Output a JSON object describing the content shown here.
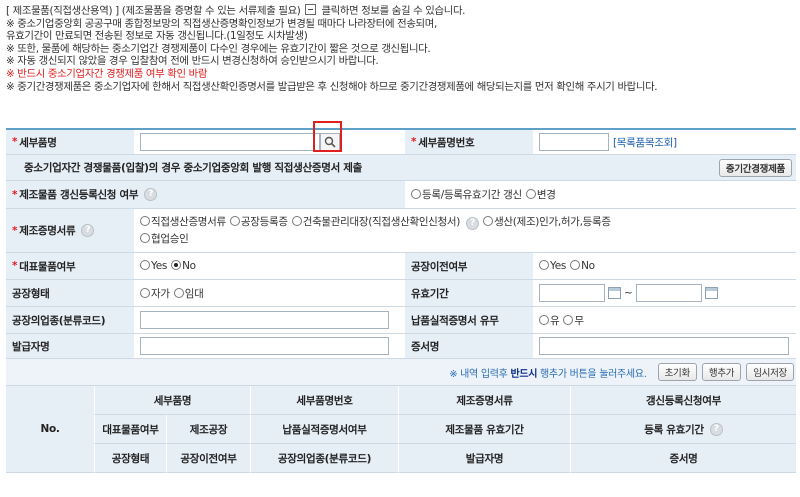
{
  "notice": {
    "line1_prefix": "[ 제조물품(직접생산용역) ] (제조물품을 증명할 수 있는 서류제출 필요)",
    "line1_suffix": "클릭하면 정보를 숨길 수 있습니다.",
    "line2": "※ 중소기업중앙회 공공구매 종합정보망의 직접생산증명확인정보가 변경될 때마다 나라장터에 전송되며,",
    "line3": "유효기간이 만료되면 전송된 정보로 자동 갱신됩니다.(1일정도 시차발생)",
    "line4": "※ 또한, 물품에 해당하는 중소기업간 경쟁제품이 다수인 경우에는 유효기간이 짧은 것으로 갱신됩니다.",
    "line5": "※ 자동 갱신되지 않았을 경우 입찰참여 전에 반드시 변경신청하여 승인받으시기 바랍니다.",
    "line6_red": "※ 반드시 중소기업자간 경쟁제품 여부 확인 바람",
    "line7": "※ 중기간경쟁제품은 중소기업자에 한해서 직접생산확인증명서를 발급받은 후 신청해야 하므로 중기간경쟁제품에 해당되는지를 먼저 확인해 주시기 바랍니다."
  },
  "form": {
    "detail_item_name_label": "세부품명",
    "detail_item_number_label": "세부품명번호",
    "catalog_link": "[목록품목조회]",
    "sme_notice": "중소기업자간 경쟁물품(입찰)의 경우 중소기업중앙회 발행 직접생산증명서 제출",
    "sme_button": "중기간경쟁제품",
    "renewal_label": "제조물품 갱신등록신청 여부",
    "renewal_options": [
      "등록/등록유효기간 갱신",
      "변경"
    ],
    "cert_label": "제조증명서류",
    "cert_options": [
      "직접생산증명서류",
      "공장등록증",
      "건축물관리대장(직접생산확인신청서)",
      "생산(제조)인가,허가,등록증",
      "협업승인"
    ],
    "main_item_label": "대표물품여부",
    "main_item_options": [
      "Yes",
      "No"
    ],
    "main_item_selected": "No",
    "factory_move_label": "공장이전여부",
    "factory_move_options": [
      "Yes",
      "No"
    ],
    "factory_type_label": "공장형태",
    "factory_type_options": [
      "자가",
      "임대"
    ],
    "validity_label": "유효기간",
    "validity_sep": "~",
    "industry_label": "공장의업종(분류코드)",
    "delivery_label": "납품실적증명서 유무",
    "delivery_options": [
      "유",
      "무"
    ],
    "issuer_label": "발급자명",
    "cert_name_label": "증서명"
  },
  "actions": {
    "msg_prefix": "※ 내역 입력후",
    "msg_bold": "반드시",
    "msg_suffix": "행추가 버튼을 눌러주세요.",
    "reset": "초기화",
    "add_row": "행추가",
    "temp_save": "임시저장"
  },
  "table": {
    "no": "No.",
    "row1": [
      "세부품명",
      "세부품명번호",
      "제조증명서류",
      "갱신등록신청여부"
    ],
    "row2": [
      "대표물품여부",
      "제조공장",
      "납품실적증명서여부",
      "제조물품 유효기간",
      "등록 유효기간"
    ],
    "row3": [
      "공장형태",
      "공장이전여부",
      "공장의업종(분류코드)",
      "발급자명",
      "증서명"
    ]
  },
  "colors": {
    "header_bg": "#e6eef6",
    "accent": "#5fa0c8",
    "required": "#e02020",
    "link": "#1b5fb0"
  }
}
